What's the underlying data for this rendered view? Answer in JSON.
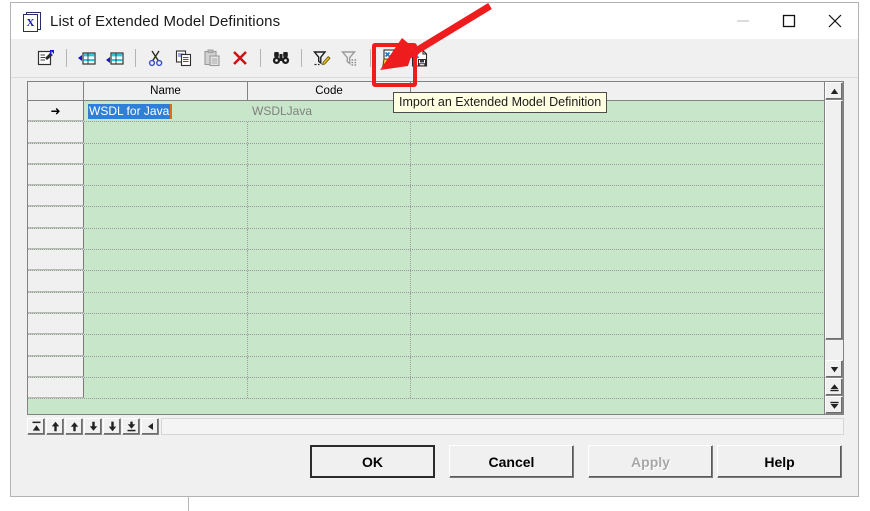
{
  "window": {
    "title": "List of Extended Model Definitions",
    "icon": "xem-document-icon",
    "controls": {
      "minimize": "—",
      "maximize": "□",
      "close": "✕"
    }
  },
  "toolbar": {
    "buttons": [
      {
        "name": "properties-icon",
        "tip": "Properties"
      },
      {
        "name": "insert-row-icon",
        "tip": "Insert a Row"
      },
      {
        "name": "add-row-icon",
        "tip": "Add a Row"
      },
      {
        "name": "cut-icon",
        "tip": "Cut"
      },
      {
        "name": "copy-icon",
        "tip": "Copy"
      },
      {
        "name": "paste-icon",
        "tip": "Paste"
      },
      {
        "name": "delete-icon",
        "tip": "Delete"
      },
      {
        "name": "find-icon",
        "tip": "Find"
      },
      {
        "name": "edit-filter-icon",
        "tip": "Customize Filter"
      },
      {
        "name": "apply-filter-icon",
        "tip": "Apply Filter"
      },
      {
        "name": "import-xem-icon",
        "tip": "Import an Extended Model Definition"
      },
      {
        "name": "export-xem-icon",
        "tip": "Export an Extended Model Definition"
      }
    ]
  },
  "tooltip": {
    "text": "Import an Extended Model Definition"
  },
  "grid": {
    "columns": [
      "",
      "Name",
      "Code",
      ""
    ],
    "rows": [
      {
        "marker": "➜",
        "name": "WSDL for Java",
        "code": "WSDLJava",
        "selected": true
      },
      {
        "marker": "",
        "name": "",
        "code": ""
      },
      {
        "marker": "",
        "name": "",
        "code": ""
      },
      {
        "marker": "",
        "name": "",
        "code": ""
      },
      {
        "marker": "",
        "name": "",
        "code": ""
      },
      {
        "marker": "",
        "name": "",
        "code": ""
      },
      {
        "marker": "",
        "name": "",
        "code": ""
      },
      {
        "marker": "",
        "name": "",
        "code": ""
      },
      {
        "marker": "",
        "name": "",
        "code": ""
      },
      {
        "marker": "",
        "name": "",
        "code": ""
      },
      {
        "marker": "",
        "name": "",
        "code": ""
      },
      {
        "marker": "",
        "name": "",
        "code": ""
      },
      {
        "marker": "",
        "name": "",
        "code": ""
      },
      {
        "marker": "",
        "name": "",
        "code": ""
      }
    ],
    "row_background": "#c8e6c9",
    "selection_background": "#2f7fd8",
    "caret_color": "#e06c1e"
  },
  "navstrip": {
    "buttons": [
      {
        "name": "go-first-icon"
      },
      {
        "name": "move-up-top-icon"
      },
      {
        "name": "move-up-icon"
      },
      {
        "name": "move-down-icon"
      },
      {
        "name": "move-down-bottom-icon"
      },
      {
        "name": "go-last-icon"
      },
      {
        "name": "scroll-left-icon"
      }
    ]
  },
  "vertical_scrollbar": {
    "buttons": [
      {
        "name": "scroll-up-icon"
      },
      {
        "name": "scroll-down-icon"
      },
      {
        "name": "page-top-icon"
      },
      {
        "name": "page-bottom-icon"
      }
    ]
  },
  "footer": {
    "ok": "OK",
    "cancel": "Cancel",
    "apply": "Apply",
    "help": "Help",
    "apply_disabled": true,
    "ok_focused": true
  },
  "annotation": {
    "highlight_color": "#ee1c1c",
    "target": "import-xem-icon"
  }
}
